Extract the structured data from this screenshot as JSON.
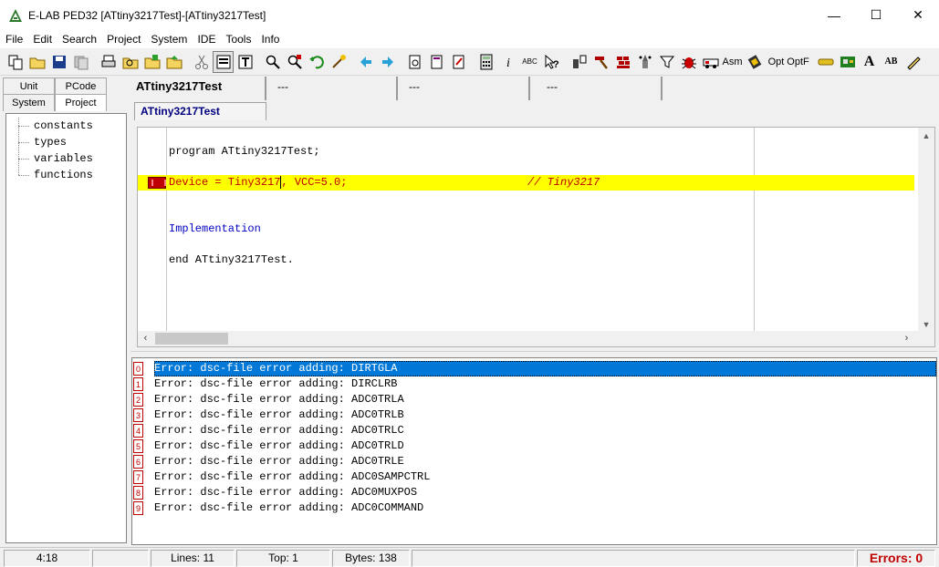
{
  "window": {
    "title": "E-LAB PED32 [ATtiny3217Test]-[ATtiny3217Test]",
    "minimize": "—",
    "maximize": "☐",
    "close": "✕"
  },
  "menu": [
    "File",
    "Edit",
    "Search",
    "Project",
    "System",
    "IDE",
    "Tools",
    "Info"
  ],
  "toolbar": {
    "asm_label": "Asm",
    "opt_label": "Opt",
    "optf_label": "OptF",
    "abc_label": "ABC",
    "font_label": "A",
    "ab_label": "AB"
  },
  "left_tabs": {
    "row1": [
      "Unit",
      "PCode"
    ],
    "row2": [
      "System",
      "Project"
    ]
  },
  "tree": [
    "constants",
    "types",
    "variables",
    "functions"
  ],
  "editor_tabs": [
    "ATtiny3217Test",
    "---",
    "---",
    "---"
  ],
  "subtab": "ATtiny3217Test",
  "code": {
    "line1": "program ATtiny3217Test;",
    "line2a": "Device = Tiny3217",
    "line2b": ", VCC=5.0;",
    "line2c": "// Tiny3217",
    "line3": "Implementation",
    "line4": "end ATtiny3217Test."
  },
  "messages": [
    {
      "n": "0",
      "text": "Error: dsc-file error adding: DIRTGLA"
    },
    {
      "n": "1",
      "text": "Error: dsc-file error adding: DIRCLRB"
    },
    {
      "n": "2",
      "text": "Error: dsc-file error adding: ADC0TRLA"
    },
    {
      "n": "3",
      "text": "Error: dsc-file error adding: ADC0TRLB"
    },
    {
      "n": "4",
      "text": "Error: dsc-file error adding: ADC0TRLC"
    },
    {
      "n": "5",
      "text": "Error: dsc-file error adding: ADC0TRLD"
    },
    {
      "n": "6",
      "text": "Error: dsc-file error adding: ADC0TRLE"
    },
    {
      "n": "7",
      "text": "Error: dsc-file error adding: ADC0SAMPCTRL"
    },
    {
      "n": "8",
      "text": "Error: dsc-file error adding: ADC0MUXPOS"
    },
    {
      "n": "9",
      "text": "Error: dsc-file error adding: ADC0COMMAND"
    }
  ],
  "status": {
    "position": "4:18",
    "lines": "Lines: 11",
    "top": "Top: 1",
    "bytes": "Bytes: 138",
    "errors": "Errors: 0"
  },
  "colors": {
    "highlight": "#ffff00",
    "selection": "#0078d7",
    "error_red": "#c00000",
    "keyword_blue": "#0000c0"
  }
}
